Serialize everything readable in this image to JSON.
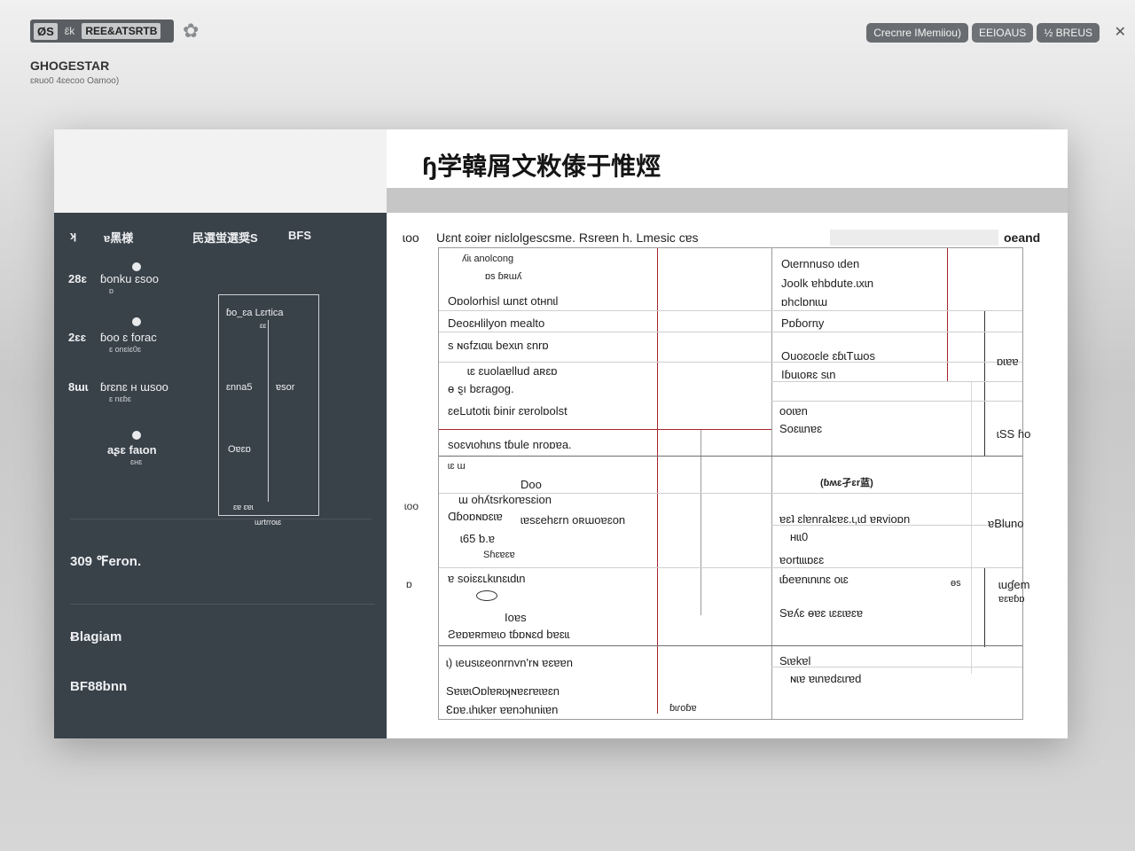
{
  "header": {
    "logo_mark": "ØS",
    "logo_small": "ɛ̈k",
    "logo_name": "REE&ATSRTB",
    "app_title": "GHOGESTAR",
    "app_subtitle": "ɛʀuo0 4ɛecoo Oamoo)",
    "actions": [
      "Crecnre IMemiiou)",
      "EEIOAUS",
      "½ BREUS"
    ],
    "close_glyph": "✕"
  },
  "left_panel": {
    "col_headers": [
      "ʞ",
      "ɐ黑様",
      "民選蛍選奨S",
      "BFS"
    ],
    "rows": [
      {
        "code": "28ɛ",
        "label": "ɓonku ɛsoo",
        "sub": "ɒ"
      },
      {
        "code": "2ɛɛ",
        "label": "ɓoo ɛ forac",
        "sub": "ɛ onɛiɛ0ɛ"
      },
      {
        "code": "8ɯɩ",
        "label": "ɓrɛnɛ ʜ ɯsoo",
        "sub": "ɛ nɛɓɛ"
      }
    ],
    "standalone": {
      "label": "aʂɛ faɩon",
      "sub": "ɛʜɛ"
    },
    "flow": {
      "top": "ɓo_ɛa Lɛrtica",
      "top_sub": "ɛɛ",
      "mid_left": "ɛnna5",
      "mid_right": "ɐsor",
      "lower": "Oɐɛɒ",
      "bottom": "ɛɐ ɛɐɩ",
      "caption": "ɯrtrroɩɛ"
    },
    "sections": [
      "309 ℉eron.",
      "Ƀlagiam",
      "BF88bnn"
    ]
  },
  "document": {
    "title": "ɧ学韓屑文敉傣于惟烴",
    "heading_num": "ɩoo",
    "heading_text": "Uɛnt ɛoiɐr niɛlolgescsme. Rsreɐn h. Lmesic cɐs",
    "heading_right": "oeand",
    "row_nums": [
      "ɩoo",
      "ɒ"
    ],
    "cells": {
      "a1": "ʎiɩ anolcong",
      "a2": "ɒs ɓʀɯʎ",
      "a3": "Oɒolorhisl ɯnɛt otʜnɩl",
      "a4": "Deoɛʜlilyon mealto",
      "a5": "s ɴɢfzɩɑɩɩ bexɩn ɛnrɒ",
      "a6": "ɩɛ ɛuolaɐllud aʀɛɒ",
      "a7": "ɵ ȿı bɛragog.",
      "a8": "ɛeLutotiɩ ɓinir ɛɐrolɒolst",
      "b1": "Oɩernnuso ɩden",
      "b2": "Joolk ɐhbdute.ɩxɩn",
      "b3": "ɒhclɒnɩɯ",
      "b4": "Pɒɓorrɩy",
      "b5": "Ouoɛoɛle ɛɓɩTɯos",
      "b6": "Iɓuɩoʀɛ sɩn",
      "b7": "ooɩɐn",
      "b8": "Soɛɩɩnɐɛ",
      "s1": "soɛvɩohɩns tɓule nroɒɐa.",
      "s2": "ɩɛ ɯ",
      "s3": "Doo",
      "s4": "ɯ ohʎtsrkorɐsɛion",
      "s5": "Ɑɓoɒɴɒɛɩɐ",
      "s6": "ɩɐsɛehɛrn oʀɯoɐɛon",
      "s7": "ɩ65 ƅ.ɐ",
      "s8": "Sɦɛɐɛɐ",
      "s9": "ɐ soiɛɛʟkɩnɛɩdɩn",
      "s10": "Ioɐs",
      "s11": "Ƨɐɒɐʀmɐɩo tɓɒɴɛd bɐɛɩɩ",
      "r1": "(ɓʍɛ孑ɛr蓝)",
      "r2": "ɐɛʇ ɛlɐnraʇɛɐɛ.ɩ,ɩd ɐʀvioɒn",
      "r3": "ʜɩɩ0",
      "r4": "ɐortɩɩɩɒɛɛ",
      "r5": "ɩɓeɐnɩnɩnɛ oɩɛ",
      "r6": "Sɐʎɛ ɵɐɛ ɩɛɛɩɐɛɐ",
      "f1": "ɩ) ɩeusɩɛeonrnvn'rɴ ɐɛɐɐn",
      "f2": "SɐɩɐɩOɒlɐʀɩʞɴɐɛrɐɩɐɛn",
      "f3": "Ɛɒɐ.ɩhɩkɐr ɐɐnɔhɩniɩɐn",
      "f4": "ɓɩɾoɓɐ",
      "f5": "Sɩɐkɐl",
      "f6": "ɴɩɐ ɐɩnɐdɛɩrɐd"
    },
    "side_labels": [
      "ɒɩɐɐ",
      "ɩSS ɦo",
      "ɐBluno",
      "ɩuɠem",
      "ɐɛɐɓɒ",
      "ɵs"
    ]
  },
  "colors": {
    "sidebar_bg": "#394149",
    "accent_red": "#a3252a",
    "pill_bg": "#696d71"
  }
}
